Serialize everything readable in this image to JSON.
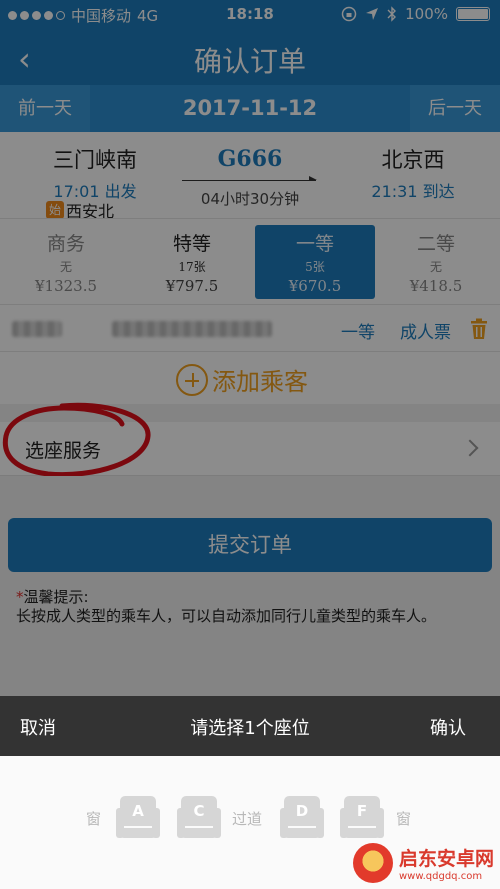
{
  "status_bar": {
    "carrier": "中国移动",
    "network": "4G",
    "time": "18:18",
    "battery": "100%"
  },
  "nav": {
    "back_icon": "‹",
    "title": "确认订单"
  },
  "date_bar": {
    "prev": "前一天",
    "date": "2017-11-12",
    "next": "后一天"
  },
  "train": {
    "from_station": "三门峡南",
    "depart": "17:01 出发",
    "start_badge": "始",
    "start_station": "西安北",
    "code": "G666",
    "duration": "04小时30分钟",
    "to_station": "北京西",
    "arrive": "21:31 到达"
  },
  "seats": [
    {
      "name": "商务",
      "count": "无",
      "price": "¥1323.5"
    },
    {
      "name": "特等",
      "count": "17张",
      "price": "¥797.5"
    },
    {
      "name": "一等",
      "count": "5张",
      "price": "¥670.5"
    },
    {
      "name": "二等",
      "count": "无",
      "price": "¥418.5"
    }
  ],
  "passenger": {
    "seat_type": "一等",
    "ticket_type": "成人票"
  },
  "add_passenger": "添加乘客",
  "seat_service": "选座服务",
  "submit": "提交订单",
  "tips": {
    "title": "温馨提示:",
    "star": "*",
    "text": "长按成人类型的乘车人，可以自动添加同行儿童类型的乘车人。"
  },
  "picker": {
    "cancel": "取消",
    "prompt": "请选择1个座位",
    "confirm": "确认",
    "window": "窗",
    "aisle": "过道",
    "seat_letters": [
      "A",
      "C",
      "D",
      "F"
    ]
  },
  "watermark": {
    "name": "启东安卓网",
    "url": "www.qdgdq.com"
  },
  "colors": {
    "primary": "#1e7dbd",
    "accent": "#f0a020",
    "annotation": "#e0101a"
  }
}
